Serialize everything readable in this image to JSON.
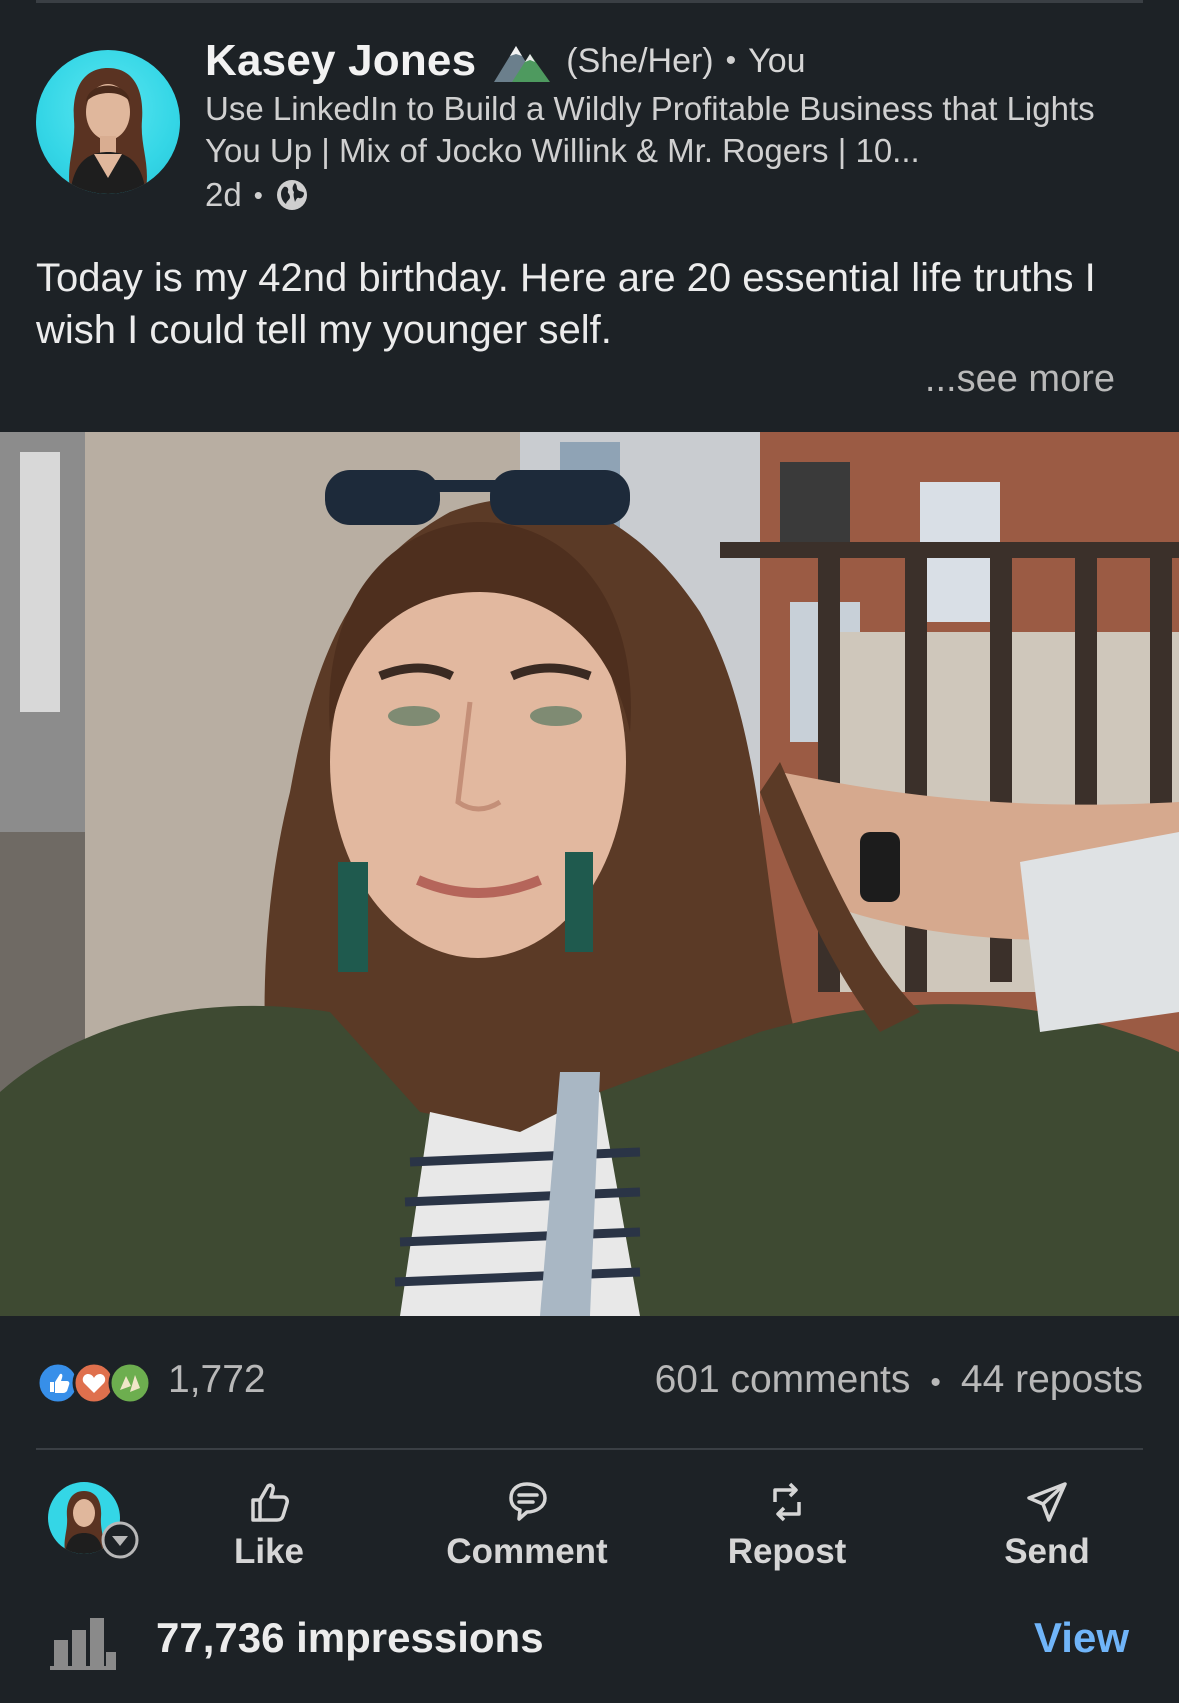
{
  "post": {
    "author_name": "Kasey Jones",
    "pronouns": "(She/Her)",
    "relationship": "You",
    "headline": "Use LinkedIn to Build a Wildly Profitable Business that Lights You Up | Mix of Jocko Willink & Mr. Rogers | 10...",
    "time_ago": "2d",
    "visibility_icon": "globe-icon",
    "badge_icon": "mountain-icon",
    "text": "Today is my 42nd birthday. Here are 20 essential life truths I wish I could tell my younger self.",
    "see_more": "...see more",
    "bullet": "•"
  },
  "stats": {
    "reaction_icons": [
      "like-reaction-icon",
      "love-reaction-icon",
      "celebrate-reaction-icon"
    ],
    "reaction_count": "1,772",
    "comments": "601 comments",
    "separator": "•",
    "reposts": "44 reposts"
  },
  "actions": [
    {
      "label": "Like",
      "icon": "thumbs-up-icon"
    },
    {
      "label": "Comment",
      "icon": "comment-icon"
    },
    {
      "label": "Repost",
      "icon": "repost-icon"
    },
    {
      "label": "Send",
      "icon": "send-icon"
    }
  ],
  "impressions": {
    "text": "77,736 impressions",
    "view_label": "View",
    "icon": "bar-chart-icon"
  },
  "colors": {
    "background": "#1d2226",
    "link": "#70b5f9",
    "avatar_bg": "#34d6e6",
    "like": "#378fe9",
    "love": "#df704d",
    "celebrate": "#6dae4f"
  }
}
